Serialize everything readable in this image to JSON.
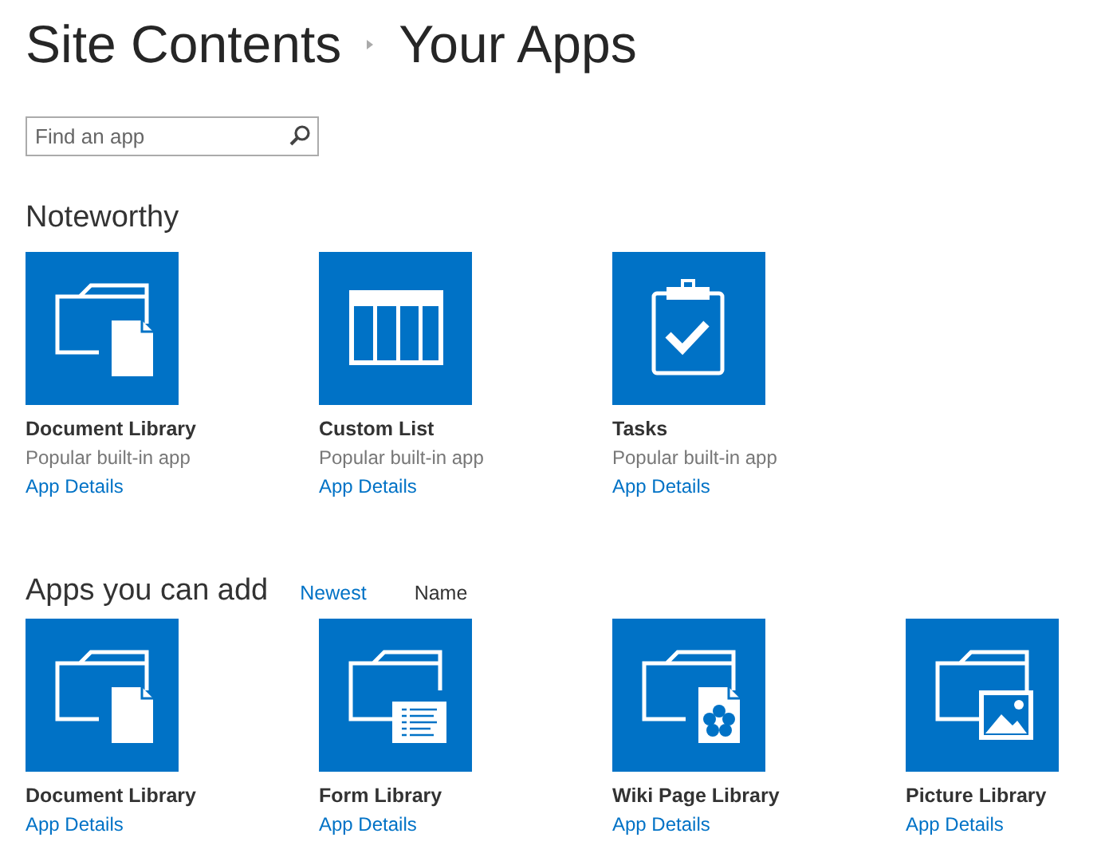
{
  "breadcrumb": [
    "Site Contents",
    "Your Apps"
  ],
  "search": {
    "placeholder": "Find an app"
  },
  "noteworthy": {
    "heading": "Noteworthy",
    "apps": [
      {
        "kind": "document",
        "name": "Document Library",
        "subtitle": "Popular built-in app",
        "link": "App Details"
      },
      {
        "kind": "list",
        "name": "Custom List",
        "subtitle": "Popular built-in app",
        "link": "App Details"
      },
      {
        "kind": "tasks",
        "name": "Tasks",
        "subtitle": "Popular built-in app",
        "link": "App Details"
      }
    ]
  },
  "apps_you_can_add": {
    "heading": "Apps you can add",
    "sort_options": [
      {
        "label": "Newest",
        "selected": false
      },
      {
        "label": "Name",
        "selected": true
      }
    ],
    "apps": [
      {
        "kind": "document",
        "name": "Document Library",
        "link": "App Details"
      },
      {
        "kind": "form",
        "name": "Form Library",
        "link": "App Details"
      },
      {
        "kind": "wiki",
        "name": "Wiki Page Library",
        "link": "App Details"
      },
      {
        "kind": "picture",
        "name": "Picture Library",
        "link": "App Details"
      }
    ]
  }
}
